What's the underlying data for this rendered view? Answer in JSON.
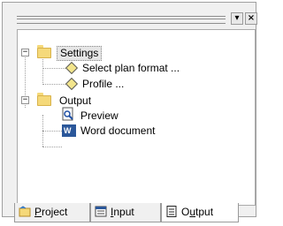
{
  "panel": {
    "controls": {
      "dropdown_glyph": "▾",
      "close_glyph": "×"
    }
  },
  "tree": {
    "nodes": [
      {
        "label": "Settings",
        "expander": "−",
        "icon": "folder-icon",
        "selected": true
      },
      {
        "label": "Select plan format ...",
        "icon": "diamond-icon"
      },
      {
        "label": "Profile ...",
        "icon": "diamond-icon"
      },
      {
        "label": "Output",
        "expander": "−",
        "icon": "folder-icon"
      },
      {
        "label": "Preview",
        "icon": "print-preview-icon"
      },
      {
        "label": "Word document",
        "icon": "word-icon",
        "icon_text": "W"
      }
    ]
  },
  "tabs": [
    {
      "pre": "",
      "hotkey": "P",
      "post": "roject",
      "icon": "project-icon",
      "active": false
    },
    {
      "pre": "",
      "hotkey": "I",
      "post": "nput",
      "icon": "input-icon",
      "active": false
    },
    {
      "pre": "O",
      "hotkey": "u",
      "post": "tput",
      "icon": "output-icon",
      "active": true
    }
  ],
  "colors": {
    "folder": "#f5d97a",
    "diamond": "#f3e58c",
    "word": "#2b579a",
    "selection": "#e6e6e6"
  }
}
